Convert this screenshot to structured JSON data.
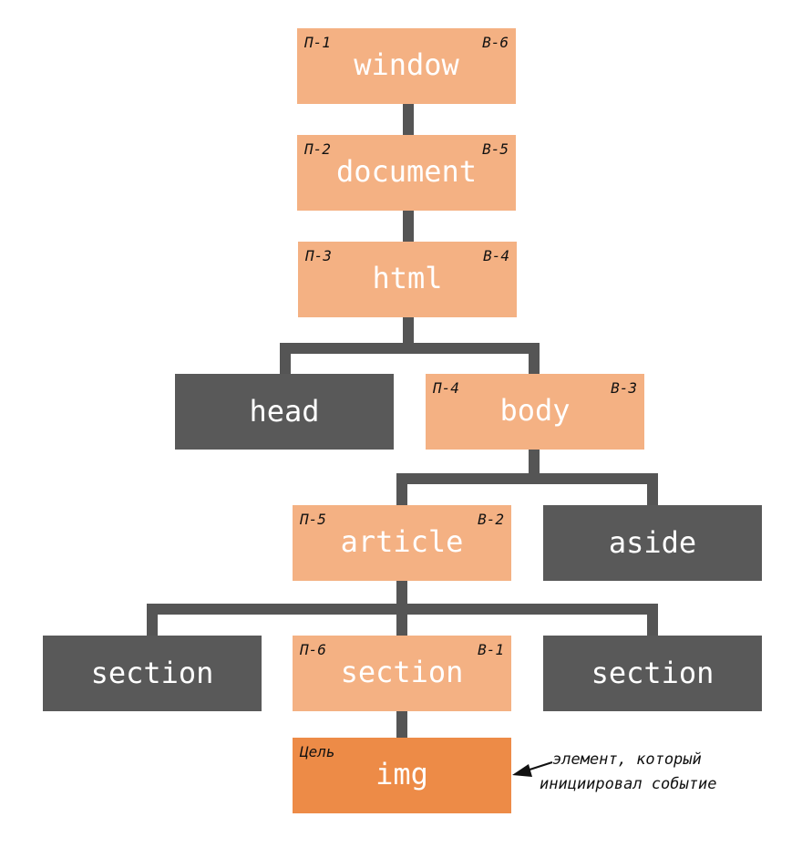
{
  "colors": {
    "phase": "#f4b183",
    "target": "#ed8b47",
    "other": "#595959",
    "connector": "#555555"
  },
  "nodes": {
    "window": {
      "name": "window",
      "capture": "П-1",
      "bubble": "В-6"
    },
    "document": {
      "name": "document",
      "capture": "П-2",
      "bubble": "В-5"
    },
    "html": {
      "name": "html",
      "capture": "П-3",
      "bubble": "В-4"
    },
    "head": {
      "name": "head"
    },
    "body": {
      "name": "body",
      "capture": "П-4",
      "bubble": "В-3"
    },
    "article": {
      "name": "article",
      "capture": "П-5",
      "bubble": "В-2"
    },
    "aside": {
      "name": "aside"
    },
    "section_left": {
      "name": "section"
    },
    "section_mid": {
      "name": "section",
      "capture": "П-6",
      "bubble": "В-1"
    },
    "section_right": {
      "name": "section"
    },
    "img": {
      "name": "img",
      "target_label": "Цель"
    }
  },
  "annotation": {
    "line1": "элемент, который",
    "line2": "инициировал событие"
  }
}
